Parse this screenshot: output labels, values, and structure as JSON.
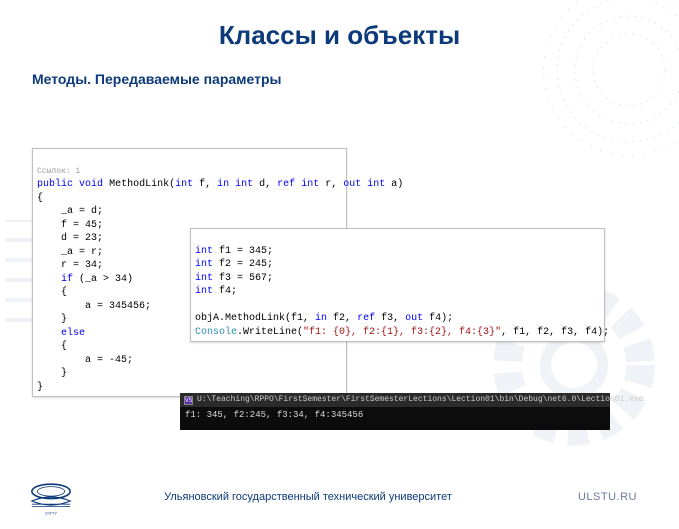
{
  "title": "Классы и объекты",
  "subtitle": "Методы. Передаваемые параметры",
  "code1": {
    "ref": "Ссылок: 1",
    "sig_kw1": "public",
    "sig_kw2": "void",
    "sig_name": "MethodLink",
    "sig_open": "(",
    "sig_p1_t": "int",
    "sig_p1_n": " f, ",
    "sig_p2_k": "in",
    "sig_p2_t": " int",
    "sig_p2_n": " d, ",
    "sig_p3_k": "ref",
    "sig_p3_t": " int",
    "sig_p3_n": " r, ",
    "sig_p4_k": "out",
    "sig_p4_t": " int",
    "sig_p4_n": " a",
    "sig_close": ")",
    "l_brace": "{",
    "b1": "    _a = d;",
    "b2": "    f = 45;",
    "b3": "    d = 23;",
    "b4": "    _a = r;",
    "b5": "    r = 34;",
    "if_kw": "if",
    "if_cond": " (_a > 34)",
    "b6": "    {",
    "b7": "        a = 345456;",
    "b8": "    }",
    "else_kw": "else",
    "b9": "    {",
    "b10": "        a = -45;",
    "b11": "    }",
    "r_brace": "}"
  },
  "code2": {
    "t_int": "int",
    "d1": " f1 = 345;",
    "d2": " f2 = 245;",
    "d3": " f3 = 567;",
    "d4": " f4;",
    "call_obj": "objA.MethodLink(f1, ",
    "call_in": "in",
    "call_p2": " f2, ",
    "call_ref": "ref",
    "call_p3": " f3, ",
    "call_out": "out",
    "call_p4": " f4);",
    "con_cls": "Console",
    "con_wl": ".WriteLine(",
    "con_str": "\"f1: {0}, f2:{1}, f3:{2}, f4:{3}\"",
    "con_args": ", f1, f2, f3, f4);"
  },
  "console": {
    "icon_text": "VS",
    "title": "U:\\Teaching\\RPPO\\FirstSemester\\FirstSemesterLections\\Lection01\\bin\\Debug\\net6.0\\Lection01.exe",
    "output": "f1: 345, f2:245, f3:34, f4:345456"
  },
  "footer": {
    "university": "Ульяновский государственный технический университет",
    "site": "ULSTU.RU"
  }
}
